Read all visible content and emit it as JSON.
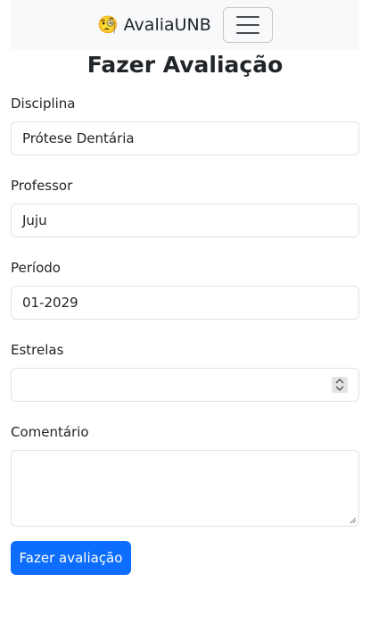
{
  "navbar": {
    "brand_emoji": "🧐",
    "brand_label": "AvaliaUNB",
    "toggler_icon": "hamburger-menu-icon"
  },
  "page": {
    "title": "Fazer Avaliação"
  },
  "form": {
    "disciplina": {
      "label": "Disciplina",
      "value": "Prótese Dentária"
    },
    "professor": {
      "label": "Professor",
      "value": "Juju"
    },
    "periodo": {
      "label": "Período",
      "value": "01-2029"
    },
    "estrelas": {
      "label": "Estrelas",
      "value": ""
    },
    "comentario": {
      "label": "Comentário",
      "value": ""
    },
    "submit_label": "Fazer avaliação"
  },
  "colors": {
    "primary": "#0d6efd",
    "navbar_bg": "#f8f9fa",
    "border": "#dee2e6"
  }
}
